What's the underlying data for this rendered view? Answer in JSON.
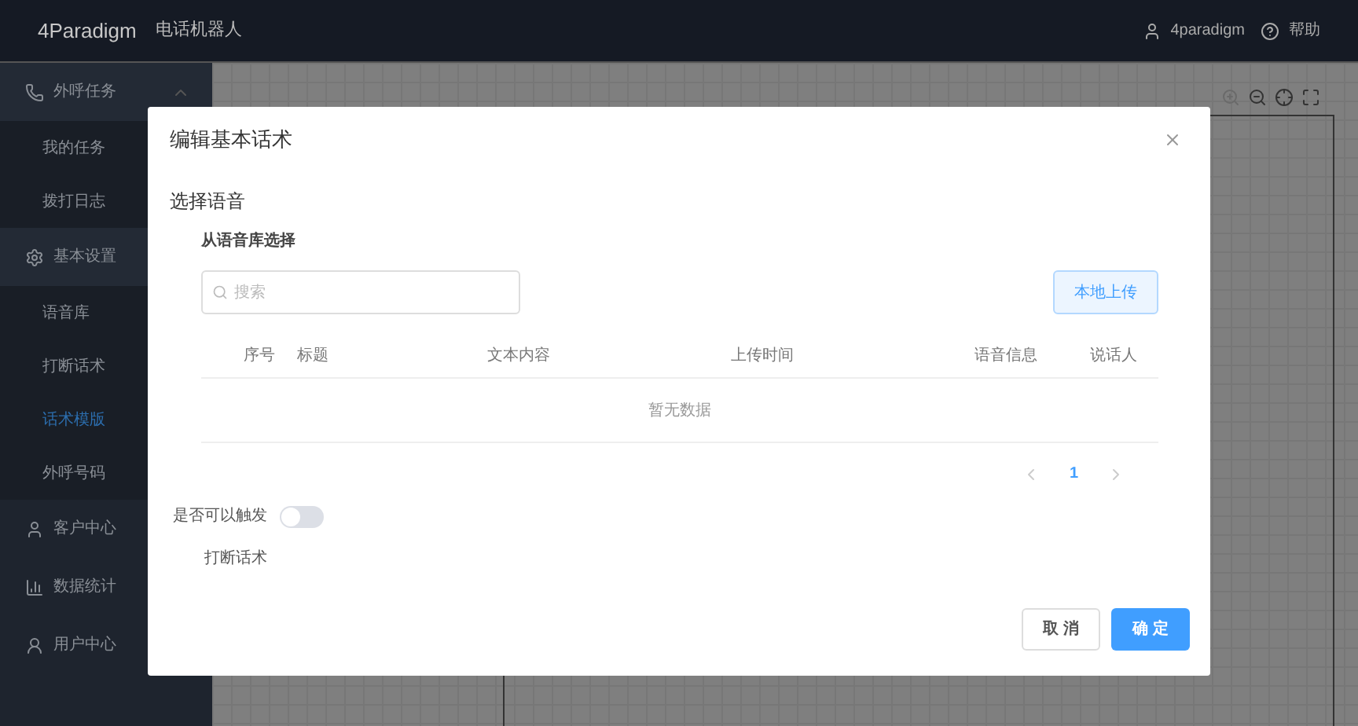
{
  "header": {
    "logo": "4Paradigm",
    "app_title": "电话机器人",
    "user": "4paradigm",
    "help": "帮助"
  },
  "sidebar": {
    "items": [
      {
        "label": "外呼任务",
        "expanded": true,
        "children": [
          {
            "label": "我的任务",
            "selected": false
          },
          {
            "label": "拨打日志",
            "selected": false
          }
        ]
      },
      {
        "label": "基本设置",
        "expanded": true,
        "children": [
          {
            "label": "语音库",
            "selected": false
          },
          {
            "label": "打断话术",
            "selected": false
          },
          {
            "label": "话术模版",
            "selected": true
          },
          {
            "label": "外呼号码",
            "selected": false
          }
        ]
      },
      {
        "label": "客户中心"
      },
      {
        "label": "数据统计"
      },
      {
        "label": "用户中心"
      }
    ]
  },
  "dialog": {
    "title": "编辑基本话术",
    "section_title": "选择语音",
    "subsection_title": "从语音库选择",
    "search": {
      "placeholder": "搜索"
    },
    "upload_button": "本地上传",
    "table": {
      "columns": [
        "序号",
        "标题",
        "文本内容",
        "上传时间",
        "语音信息",
        "说话人"
      ],
      "empty_text": "暂无数据"
    },
    "pagination": {
      "pages": [
        {
          "label": "1",
          "selected": true
        }
      ]
    },
    "trigger_toggle": {
      "label": "是否可以触发",
      "on": false
    },
    "interrupt_label": "打断话术",
    "buttons": [
      {
        "label": "取 消",
        "kind": "default"
      },
      {
        "label": "确 定",
        "kind": "primary"
      }
    ]
  }
}
